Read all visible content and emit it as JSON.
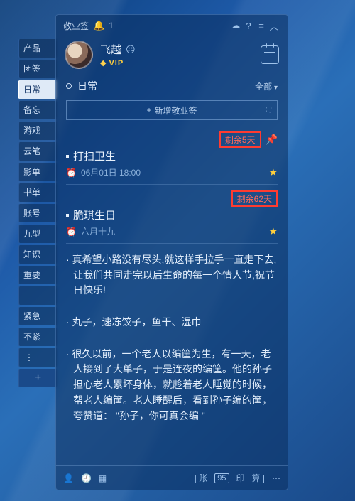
{
  "titlebar": {
    "app_name": "敬业签",
    "notif_count": "1"
  },
  "profile": {
    "username": "飞越",
    "vip_label": "VIP"
  },
  "category": {
    "name": "日常",
    "filter_label": "全部"
  },
  "add_button": {
    "label": "新增敬业签"
  },
  "side_tabs": [
    "产品",
    "团签",
    "日常",
    "备忘",
    "游戏",
    "云笔",
    "影单",
    "书单",
    "账号",
    "九型",
    "知识",
    "重要",
    "",
    "紧急",
    "不紧"
  ],
  "notes": [
    {
      "badge": "剩余5天",
      "pinned": true,
      "title": "打扫卫生",
      "time": "06月01日  18:00",
      "starred": true
    },
    {
      "badge": "剩余62天",
      "pinned": false,
      "title": "脆琪生日",
      "time": "六月十九",
      "starred": true
    },
    {
      "text": "真希望小路没有尽头,就这样手拉手一直走下去,让我们共同走完以后生命的每一个情人节,祝节日快乐!"
    },
    {
      "text": "丸子，速冻饺子，鱼干、湿巾"
    },
    {
      "text": "很久以前，一个老人以编筐为生，有一天，老人接到了大单子，于是连夜的编筐。他的孙子担心老人累坏身体，就趁着老人睡觉的时候，帮老人编筐。老人睡醒后，看到孙子编的筐，夸赞道：  \"孙子，你可真会编  \""
    }
  ],
  "bottombar": {
    "items": [
      "账",
      "95",
      "印",
      "算"
    ]
  }
}
